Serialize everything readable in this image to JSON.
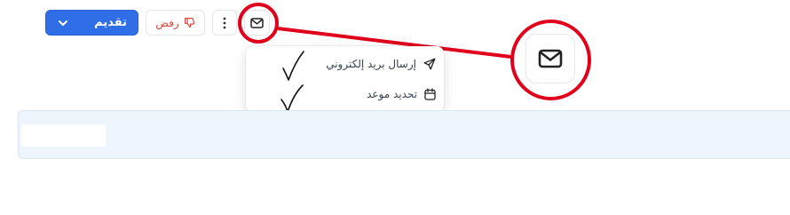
{
  "toolbar": {
    "submit_label": "تقديم",
    "reject_label": "رفض",
    "submit_icon": "chevron-down-icon",
    "reject_icon": "thumbs-down-icon",
    "more_icon": "vertical-dots-icon",
    "mail_icon": "envelope-icon"
  },
  "menu": {
    "items": [
      {
        "label": "إرسال بريد إلكتروني",
        "icon": "send-icon"
      },
      {
        "label": "تحديد موعد",
        "icon": "calendar-icon"
      }
    ]
  },
  "colors": {
    "primary": "#2f6ee6",
    "danger": "#d9443b",
    "annotation": "#e0001b",
    "panel": "#eef5fd"
  }
}
